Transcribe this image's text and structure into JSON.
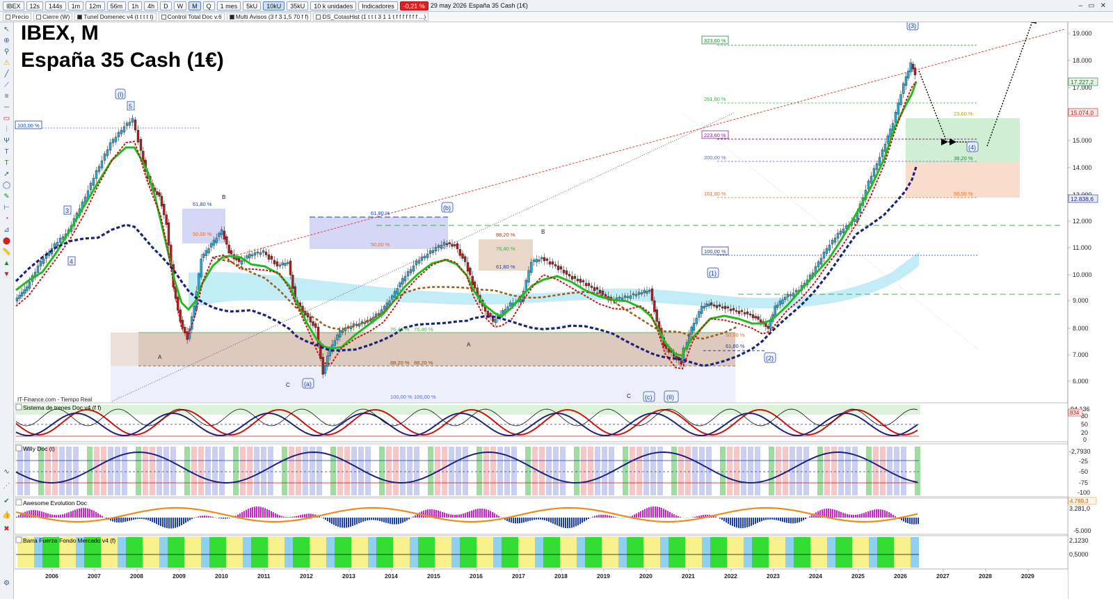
{
  "toolbar": {
    "symbol": "IBEX",
    "timeframes": [
      "12s",
      "144s",
      "1m",
      "12m",
      "56m",
      "1h",
      "4h",
      "D",
      "W",
      "M",
      "Q"
    ],
    "selected_timeframe": "M",
    "range": "1 mes",
    "units": [
      "5kU",
      "10kU",
      "35kU"
    ],
    "selected_unit": "10kU",
    "unit_mode": "10 k unidades",
    "indicators_label": "Indicadores",
    "change": "-0,21 %",
    "date": "29 may 2026",
    "instrument": "España 35 Cash (1€)"
  },
  "indicator_bar": [
    {
      "label": "Precio"
    },
    {
      "label": "Cierre (W)"
    },
    {
      "label": "Tunel Domenec v4 (t t t t t)"
    },
    {
      "label": "Control Total Doc v.6"
    },
    {
      "label": "Multi Avisos (3 f 3 1,5 70 f f)"
    },
    {
      "label": "DS_CotasHist (1 t t t 3 1 1 t f f f f f f f ...)"
    }
  ],
  "chart": {
    "title": "IBEX, M",
    "subtitle": "España 35 Cash (1€)",
    "source": "IT-Finance.com - Tiempo Real",
    "price_axis": [
      "19.000",
      "18.000",
      "17.000",
      "16.000",
      "15.000",
      "14.000",
      "13.000",
      "12.000",
      "11.000",
      "10.000",
      "9.000",
      "8.000",
      "7.000",
      "6.000"
    ],
    "price_tags": [
      {
        "text": "17.227,2",
        "color": "#1f6f2f"
      },
      {
        "text": "15.074,0",
        "color": "#c81414"
      },
      {
        "text": "12.838,6",
        "color": "#1a2a8a"
      }
    ],
    "years": [
      "2006",
      "2007",
      "2008",
      "2009",
      "2010",
      "2011",
      "2012",
      "2013",
      "2014",
      "2015",
      "2016",
      "2017",
      "2018",
      "2019",
      "2020",
      "2021",
      "2022",
      "2023",
      "2024",
      "2025",
      "2026",
      "2027",
      "2028",
      "2029"
    ],
    "fib_labels": [
      {
        "text": "323,60 %",
        "color": "#1f8a2f"
      },
      {
        "text": "261,80 %",
        "color": "#3db04a"
      },
      {
        "text": "223,60 %",
        "color": "#8a1fa0"
      },
      {
        "text": "200,00 %",
        "color": "#5b6fc0"
      },
      {
        "text": "161,80 %",
        "color": "#e0702a"
      },
      {
        "text": "100,00 %",
        "color": "#1a3db0"
      },
      {
        "text": "100,00 %",
        "color": "#1a3db0"
      },
      {
        "text": "23,60 %",
        "color": "#b8a000"
      },
      {
        "text": "38,20 %",
        "color": "#1f8a2f"
      },
      {
        "text": "50,00 %",
        "color": "#e0702a"
      },
      {
        "text": "61,80 %",
        "color": "#1a3db0"
      },
      {
        "text": "50,00 %",
        "color": "#e0702a"
      },
      {
        "text": "61,80 %",
        "color": "#1a3db0"
      },
      {
        "text": "50,00 %",
        "color": "#e0702a"
      },
      {
        "text": "88,20 %",
        "color": "#8a4a10"
      },
      {
        "text": "76,40 %",
        "color": "#3db04a"
      },
      {
        "text": "61,80 %",
        "color": "#1a3db0"
      },
      {
        "text": "76,40 %",
        "color": "#3db04a"
      },
      {
        "text": "76,40 %",
        "color": "#3db04a"
      },
      {
        "text": "88,20 %",
        "color": "#8a4a10"
      },
      {
        "text": "88,20 %",
        "color": "#8a4a10"
      },
      {
        "text": "100,00 %",
        "color": "#5b6fc0"
      },
      {
        "text": "100,00 %",
        "color": "#5b6fc0"
      },
      {
        "text": "50,00 %",
        "color": "#e0702a"
      },
      {
        "text": "61,80 %",
        "color": "#1a3db0"
      }
    ],
    "wave_labels": [
      "(I)",
      "5",
      "3",
      "4",
      "B",
      "A",
      "C",
      "(a)",
      "(b)",
      "A",
      "B",
      "C",
      "(c)",
      "(II)",
      "(1)",
      "(2)",
      "(3)",
      "(4)"
    ]
  },
  "panels": [
    {
      "title": "Sistema de trenes Doc v4 (f f)",
      "axis": [
        "94,136",
        "80",
        "50",
        "20",
        "0"
      ],
      "tag": "834"
    },
    {
      "title": "Willy Doc (t)",
      "axis": [
        "-2,7930",
        "-25",
        "-50",
        "-75",
        "-100"
      ]
    },
    {
      "title": "Awesome Evolution Doc",
      "axis": [
        "3.281,0",
        "-5.000"
      ],
      "tag": "4.789,3"
    },
    {
      "title": "Barra Fuerza Fondo Mercado v4 (f)",
      "axis": [
        "2,1230",
        "0,5000"
      ]
    }
  ],
  "colors": {
    "candle_up": "#2aa8d8",
    "candle_down": "#b02020",
    "ma_green": "#22bb22",
    "ma_red": "#cc1111",
    "ma_blue": "#1a237e",
    "ma_brown": "#9a5a10",
    "accent": "#2c5aa0"
  }
}
